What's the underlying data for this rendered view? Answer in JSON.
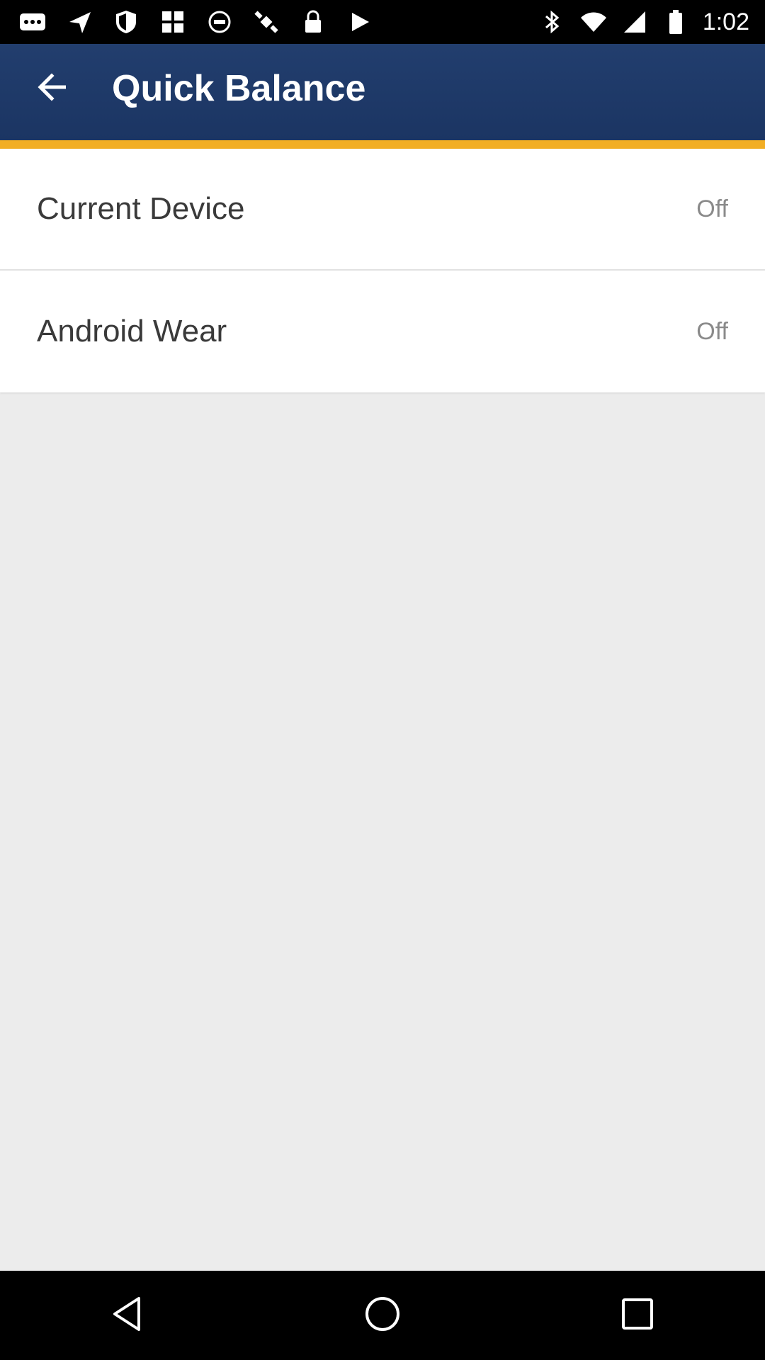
{
  "status_bar": {
    "time": "1:02",
    "left_icons": [
      "more-icon",
      "send-icon",
      "shield-icon",
      "grid-icon",
      "block-icon",
      "satellite-icon",
      "lock-icon",
      "play-store-icon"
    ],
    "right_icons": [
      "bluetooth-icon",
      "wifi-icon",
      "signal-icon",
      "battery-icon"
    ]
  },
  "header": {
    "title": "Quick Balance",
    "bar_color": "#1f3a69",
    "accent_color": "#f2ae24"
  },
  "settings": {
    "items": [
      {
        "label": "Current Device",
        "value": "Off"
      },
      {
        "label": "Android Wear",
        "value": "Off"
      }
    ]
  },
  "nav_bar": {
    "buttons": [
      "back-triangle-icon",
      "home-circle-icon",
      "recents-square-icon"
    ]
  }
}
